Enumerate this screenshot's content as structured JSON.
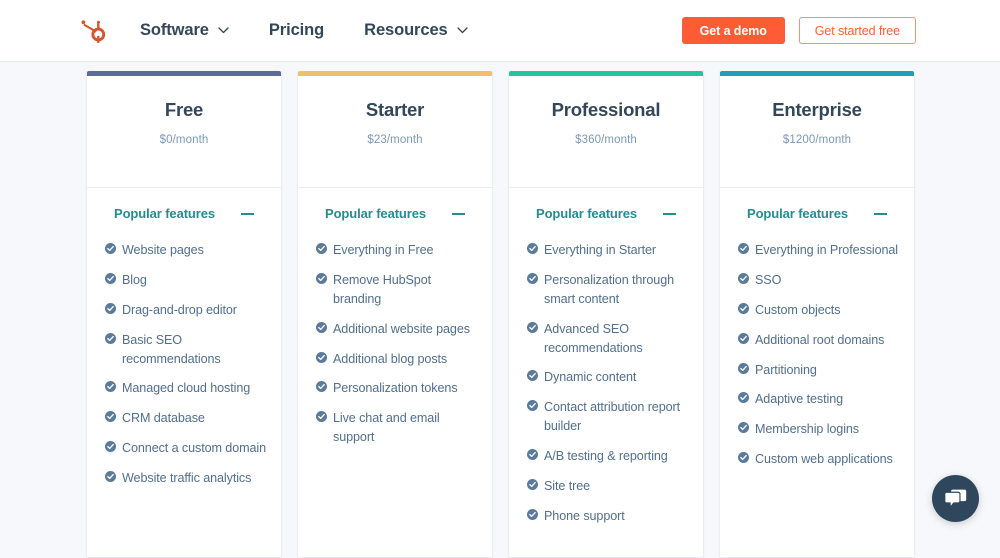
{
  "header": {
    "logo_icon": "hubspot-sprocket-logo",
    "nav": [
      {
        "label": "Software",
        "has_chevron": true
      },
      {
        "label": "Pricing",
        "has_chevron": false
      },
      {
        "label": "Resources",
        "has_chevron": true
      }
    ],
    "demo_button": "Get a demo",
    "free_button": "Get started free"
  },
  "colors": {
    "brand_orange": "#ff5c35",
    "text_dark": "#33475b",
    "text_body": "#516f90",
    "teal": "#278c92",
    "check_icon": "#5b7b9a",
    "chat_bg": "#2e475d",
    "page_bg": "#f7f8fb"
  },
  "features_section": {
    "toggle_label": "Popular features",
    "toggle_icon": "minus-icon"
  },
  "plans": [
    {
      "name": "Free",
      "price": "$0/month",
      "accent": "#5c6c9a",
      "features": [
        "Website pages",
        "Blog",
        "Drag-and-drop editor",
        "Basic SEO recommendations",
        "Managed cloud hosting",
        "CRM database",
        "Connect a custom domain",
        "Website traffic analytics"
      ]
    },
    {
      "name": "Starter",
      "price": "$23/month",
      "accent": "#eec06b",
      "features": [
        "Everything in Free",
        "Remove HubSpot branding",
        "Additional website pages",
        "Additional blog posts",
        "Personalization tokens",
        "Live chat and email support"
      ]
    },
    {
      "name": "Professional",
      "price": "$360/month",
      "accent": "#23c4a0",
      "features": [
        "Everything in Starter",
        "Personalization through smart content",
        "Advanced SEO recommendations",
        "Dynamic content",
        "Contact attribution report builder",
        "A/B testing & reporting",
        "Site tree",
        "Phone support"
      ]
    },
    {
      "name": "Enterprise",
      "price": "$1200/month",
      "accent": "#269cb8",
      "features": [
        "Everything in Professional",
        "SSO",
        "Custom objects",
        "Additional root domains",
        "Partitioning",
        "Adaptive testing",
        "Membership logins",
        "Custom web applications"
      ]
    }
  ],
  "chat": {
    "icon": "chat-bubbles-icon"
  }
}
